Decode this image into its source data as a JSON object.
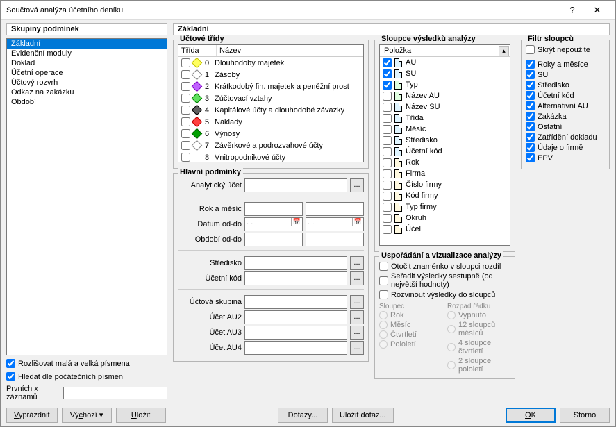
{
  "window": {
    "title": "Součtová analýza účetního deníku",
    "help": "?",
    "close": "✕"
  },
  "left": {
    "panel": "Skupiny podmínek",
    "items": [
      "Základní",
      "Evidenční moduly",
      "Doklad",
      "Účetní operace",
      "Účtový rozvrh",
      "Odkaz na zakázku",
      "Období"
    ],
    "selected": 0,
    "rozlisovat": {
      "label": "Rozlišovat malá a velká písmena",
      "checked": true
    },
    "hledat": {
      "label": "Hledat dle počátečních písmen",
      "checked": true
    },
    "prvnich": {
      "label": "Prvních x záznamů",
      "value": ""
    }
  },
  "right_title": "Základní",
  "uctove": {
    "legend": "Účtové třídy",
    "hdr_trida": "Třída",
    "hdr_nazev": "Název",
    "rows": [
      {
        "n": "0",
        "name": "Dlouhodobý majetek",
        "fill": "#ffff60",
        "stroke": "#c0c000"
      },
      {
        "n": "1",
        "name": "Zásoby",
        "fill": "#ffffff",
        "stroke": "#888"
      },
      {
        "n": "2",
        "name": "Krátkodobý fin. majetek a peněžní prost",
        "fill": "#c060ff",
        "stroke": "#8000c0"
      },
      {
        "n": "3",
        "name": "Zúčtovací vztahy",
        "fill": "#60e060",
        "stroke": "#008000"
      },
      {
        "n": "4",
        "name": "Kapitálové účty a dlouhodobé závazky",
        "fill": "#606060",
        "stroke": "#000"
      },
      {
        "n": "5",
        "name": "Náklady",
        "fill": "#ff4040",
        "stroke": "#c00000"
      },
      {
        "n": "6",
        "name": "Výnosy",
        "fill": "#00a000",
        "stroke": "#006000"
      },
      {
        "n": "7",
        "name": "Závěrkové a podrozvahové účty",
        "fill": "#ffffff",
        "stroke": "#888"
      },
      {
        "n": "8",
        "name": "Vnitropodnikové účty",
        "fill": "",
        "stroke": ""
      }
    ]
  },
  "hlavni": {
    "legend": "Hlavní podmínky",
    "rows": [
      {
        "label": "Analytický účet",
        "dots": true
      },
      {
        "label": "Rok a měsíc",
        "half": true
      },
      {
        "label": "Datum od-do",
        "half": true,
        "date": true,
        "val1": ". .",
        "val2": ". ."
      },
      {
        "label": "Období od-do",
        "half": true
      },
      {
        "label": "Středisko",
        "dots": true
      },
      {
        "label": "Účetní kód",
        "dots": true
      },
      {
        "label": "Účtová skupina",
        "dots": true
      },
      {
        "label": "Účet AU2",
        "dots": true
      },
      {
        "label": "Účet AU3",
        "dots": true
      },
      {
        "label": "Účet AU4",
        "dots": true
      }
    ]
  },
  "sloupce": {
    "legend": "Sloupce výsledků analýzy",
    "hdr": "Položka",
    "items": [
      {
        "label": "AU",
        "c": "cyan",
        "chk": true
      },
      {
        "label": "SU",
        "c": "cyan",
        "chk": true
      },
      {
        "label": "Typ",
        "c": "green",
        "chk": true
      },
      {
        "label": "Název AU",
        "c": "green",
        "chk": false
      },
      {
        "label": "Název SU",
        "c": "cyan",
        "chk": false
      },
      {
        "label": "Třída",
        "c": "cyan",
        "chk": false
      },
      {
        "label": "Měsíc",
        "c": "cyan",
        "chk": false
      },
      {
        "label": "Středisko",
        "c": "cyan",
        "chk": false
      },
      {
        "label": "Účetní kód",
        "c": "cyan",
        "chk": false
      },
      {
        "label": "Rok",
        "c": "yel",
        "chk": false
      },
      {
        "label": "Firma",
        "c": "yel",
        "chk": false
      },
      {
        "label": "Číslo firmy",
        "c": "yel",
        "chk": false
      },
      {
        "label": "Kód firmy",
        "c": "yel",
        "chk": false
      },
      {
        "label": "Typ firmy",
        "c": "yel",
        "chk": false
      },
      {
        "label": "Okruh",
        "c": "yel",
        "chk": false
      },
      {
        "label": "Účel",
        "c": "yel",
        "chk": false
      }
    ]
  },
  "filtr": {
    "legend": "Filtr sloupců",
    "items": [
      {
        "label": "Skrýt nepoužité",
        "chk": false
      },
      {
        "label": "Roky a měsíce",
        "chk": true
      },
      {
        "label": "SU",
        "chk": true
      },
      {
        "label": "Středisko",
        "chk": true
      },
      {
        "label": "Účetní kód",
        "chk": true
      },
      {
        "label": "Alternativní AU",
        "chk": true
      },
      {
        "label": "Zakázka",
        "chk": true
      },
      {
        "label": "Ostatní",
        "chk": true
      },
      {
        "label": "Zatřídění dokladu",
        "chk": true
      },
      {
        "label": "Údaje o firmě",
        "chk": true
      },
      {
        "label": "EPV",
        "chk": true
      }
    ]
  },
  "usporadani": {
    "legend": "Uspořádání a vizualizace analýzy",
    "opts": [
      {
        "label": "Otočit znaménko v sloupci rozdíl",
        "chk": false
      },
      {
        "label": "Seřadit výsledky sestupně (od největší hodnoty)",
        "chk": false
      },
      {
        "label": "Rozvinout výsledky do sloupců",
        "chk": false
      }
    ],
    "sloupec_legend": "Sloupec",
    "rozpad_legend": "Rozpad řádku",
    "rad_col": [
      "Rok",
      "Měsíc",
      "Čtvrtletí",
      "Pololetí"
    ],
    "rad_roz": [
      "Vypnuto",
      "12 sloupců měsíců",
      "4 sloupce čtvrtletí",
      "2 sloupce pololetí"
    ]
  },
  "buttons": {
    "vyprazdnit": "Vyprázdnit",
    "vychozi": "Výchozí",
    "ulozit": "Uložit",
    "dotazy": "Dotazy...",
    "ulozit_dotaz": "Uložit dotaz...",
    "ok": "OK",
    "storno": "Storno",
    "dropdown": "▾",
    "ellipsis": "..."
  }
}
